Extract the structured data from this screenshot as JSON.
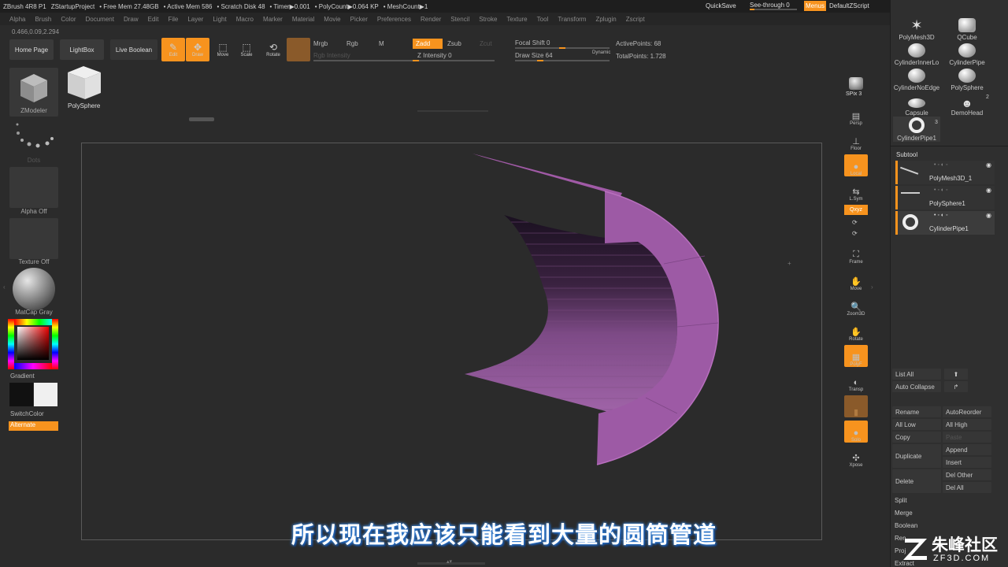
{
  "titlebar": {
    "app": "ZBrush 4R8 P1",
    "project": "ZStartupProject",
    "stats": [
      "• Free Mem 27.48GB",
      "• Active Mem 586",
      "• Scratch Disk 48",
      "• Timer▶0.001",
      "• PolyCount▶0.064 KP",
      "• MeshCount▶1"
    ],
    "quicksave": "QuickSave",
    "seethrough": "See-through  0",
    "menus": "Menus",
    "script": "DefaultZScript"
  },
  "menubar": [
    "Alpha",
    "Brush",
    "Color",
    "Document",
    "Draw",
    "Edit",
    "File",
    "Layer",
    "Light",
    "Macro",
    "Marker",
    "Material",
    "Movie",
    "Picker",
    "Preferences",
    "Render",
    "Stencil",
    "Stroke",
    "Texture",
    "Tool",
    "Transform",
    "Zplugin",
    "Zscript"
  ],
  "coords": "0.466,0.09,2.294",
  "toolbar": {
    "home": "Home Page",
    "lightbox": "LightBox",
    "liveboolean": "Live Boolean",
    "edit": "Edit",
    "draw": "Draw",
    "move": "Move",
    "scale": "Scale",
    "rotate": "Rotate",
    "mrgb": "Mrgb",
    "rgb": "Rgb",
    "m": "M",
    "zadd": "Zadd",
    "zsub": "Zsub",
    "zcut": "Zcut",
    "rgbintensity": "Rgb Intensity",
    "zintensity": "Z Intensity 0",
    "focalshift": "Focal Shift 0",
    "drawsize": "Draw Size 64",
    "dynamic": "Dynamic",
    "activepoints": "ActivePoints: 68",
    "totalpoints": "TotalPoints: 1.728"
  },
  "left": {
    "zmodeler": "ZModeler",
    "polysphere": "PolySphere",
    "dots": "Dots",
    "alpha": "Alpha Off",
    "texture": "Texture Off",
    "matcap": "MatCap Gray",
    "gradient": "Gradient",
    "switchcolor": "SwitchColor",
    "alternate": "Alternate"
  },
  "shelf": {
    "bpr": "BPR",
    "spix": "SPix 3",
    "persp": "Persp",
    "floor": "Floor",
    "local": "Local",
    "lsym": "L.Sym",
    "xyz": "Qxyz",
    "frame": "Frame",
    "move": "Move",
    "zoom3d": "Zoom3D",
    "rotate": "Rotate",
    "polyf": "PolyF",
    "transp": "Transp",
    "ghost": "Ghost",
    "solo": "Solo",
    "xpose": "Xpose"
  },
  "tools": [
    {
      "name": "PolyMesh3D"
    },
    {
      "name": "QCube"
    },
    {
      "name": "CylinderInnerLo"
    },
    {
      "name": "CylinderPipe"
    },
    {
      "name": "CylinderNoEdge"
    },
    {
      "name": "PolySphere"
    },
    {
      "name": "Capsule"
    },
    {
      "name": "DemoHead"
    },
    {
      "name": "CylinderPipe1"
    }
  ],
  "toolcounts": {
    "demohead": "2",
    "cylinderpipe1": "3"
  },
  "subtool": {
    "title": "Subtool",
    "items": [
      "PolyMesh3D_1",
      "PolySphere1",
      "CylinderPipe1"
    ]
  },
  "rp": {
    "listall": "List All",
    "autocollapse": "Auto Collapse",
    "rename": "Rename",
    "autoreorder": "AutoReorder",
    "alllow": "All Low",
    "allhigh": "All High",
    "copy": "Copy",
    "paste": "Paste",
    "duplicate": "Duplicate",
    "append": "Append",
    "insert": "Insert",
    "delete": "Delete",
    "delother": "Del Other",
    "delall": "Del All",
    "split": "Split",
    "merge": "Merge",
    "boolean": "Boolean",
    "remesh": "Remesh",
    "project": "Project",
    "extract": "Extract"
  },
  "subtitle": "所以现在我应该只能看到大量的圆筒管道",
  "watermark": {
    "brand": "朱峰社区",
    "url": "ZF3D.COM"
  }
}
